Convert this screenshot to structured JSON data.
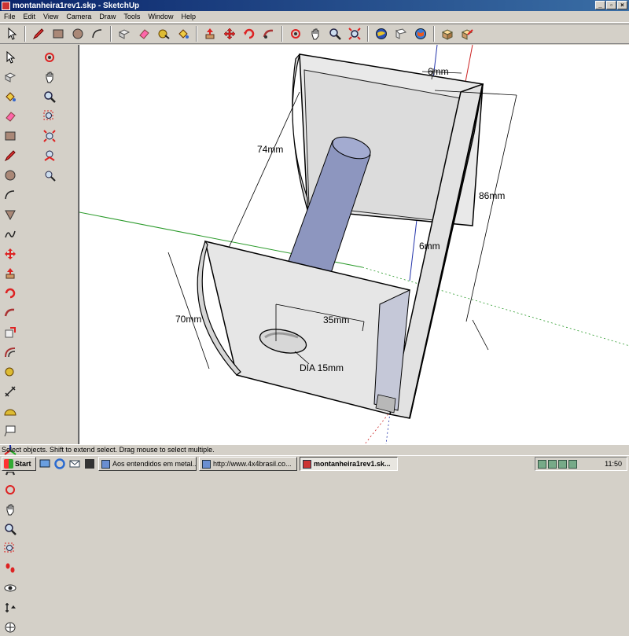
{
  "window": {
    "title": "montanheira1rev1.skp - SketchUp"
  },
  "menu": [
    "File",
    "Edit",
    "View",
    "Camera",
    "Draw",
    "Tools",
    "Window",
    "Help"
  ],
  "toolbar_icons": [
    "select-icon",
    "pencil-icon",
    "rectangle-icon",
    "circle-icon",
    "arc-icon",
    "make-component-icon",
    "eraser-icon",
    "tape-measure-icon",
    "paint-bucket-icon",
    "push-pull-icon",
    "move-icon",
    "rotate-icon",
    "follow-me-icon",
    "orbit-icon",
    "pan-icon",
    "zoom-icon",
    "zoom-extents-icon",
    "get-models-icon",
    "share-model-icon",
    "google-earth-icon",
    "component-icon",
    "dynamic-component-icon"
  ],
  "left_tools": [
    "select-icon",
    "component-icon",
    "push-pull-icon",
    "hand-icon",
    "paint-bucket-icon",
    "eraser-icon",
    "zoom-icon",
    "zoom-window-icon",
    "rectangle-icon",
    "pencil-icon",
    "zoom-extents-icon",
    "previous-view-icon",
    "circle-icon",
    "arc-icon",
    "section-icon",
    "polygon-icon",
    "freehand-icon",
    "move-icon",
    "rotate-icon",
    "scale-icon",
    "follow-me-icon",
    "offset-icon",
    "tape-measure-icon",
    "dimension-icon",
    "protractor-icon",
    "text-icon",
    "axes-icon",
    "3d-text-icon",
    "orbit-icon",
    "pan-icon",
    "zoom-icon",
    "zoom-window-icon",
    "walk-icon",
    "look-around-icon",
    "position-camera-icon",
    "position-icon"
  ],
  "dimensions": {
    "d1": "6mm",
    "d2": "74mm",
    "d3": "86mm",
    "d4": "6mm",
    "d5": "70mm",
    "d6": "35mm",
    "d7": "DIA 15mm"
  },
  "status": {
    "text": "Select objects. Shift to extend select. Drag mouse to select multiple."
  },
  "taskbar": {
    "start": "Start",
    "tasks": [
      "Aos entendidos em metal...",
      "http://www.4x4brasil.co...",
      "montanheira1rev1.sk..."
    ],
    "clock": "11:50"
  },
  "colors": {
    "title_start": "#0a246a",
    "title_end": "#3a6ea5",
    "face": "#e6e6e6",
    "cylinder": "#8d96bf",
    "axis_green": "#2a9a2a",
    "axis_red": "#cc2222",
    "axis_blue": "#2233aa"
  }
}
